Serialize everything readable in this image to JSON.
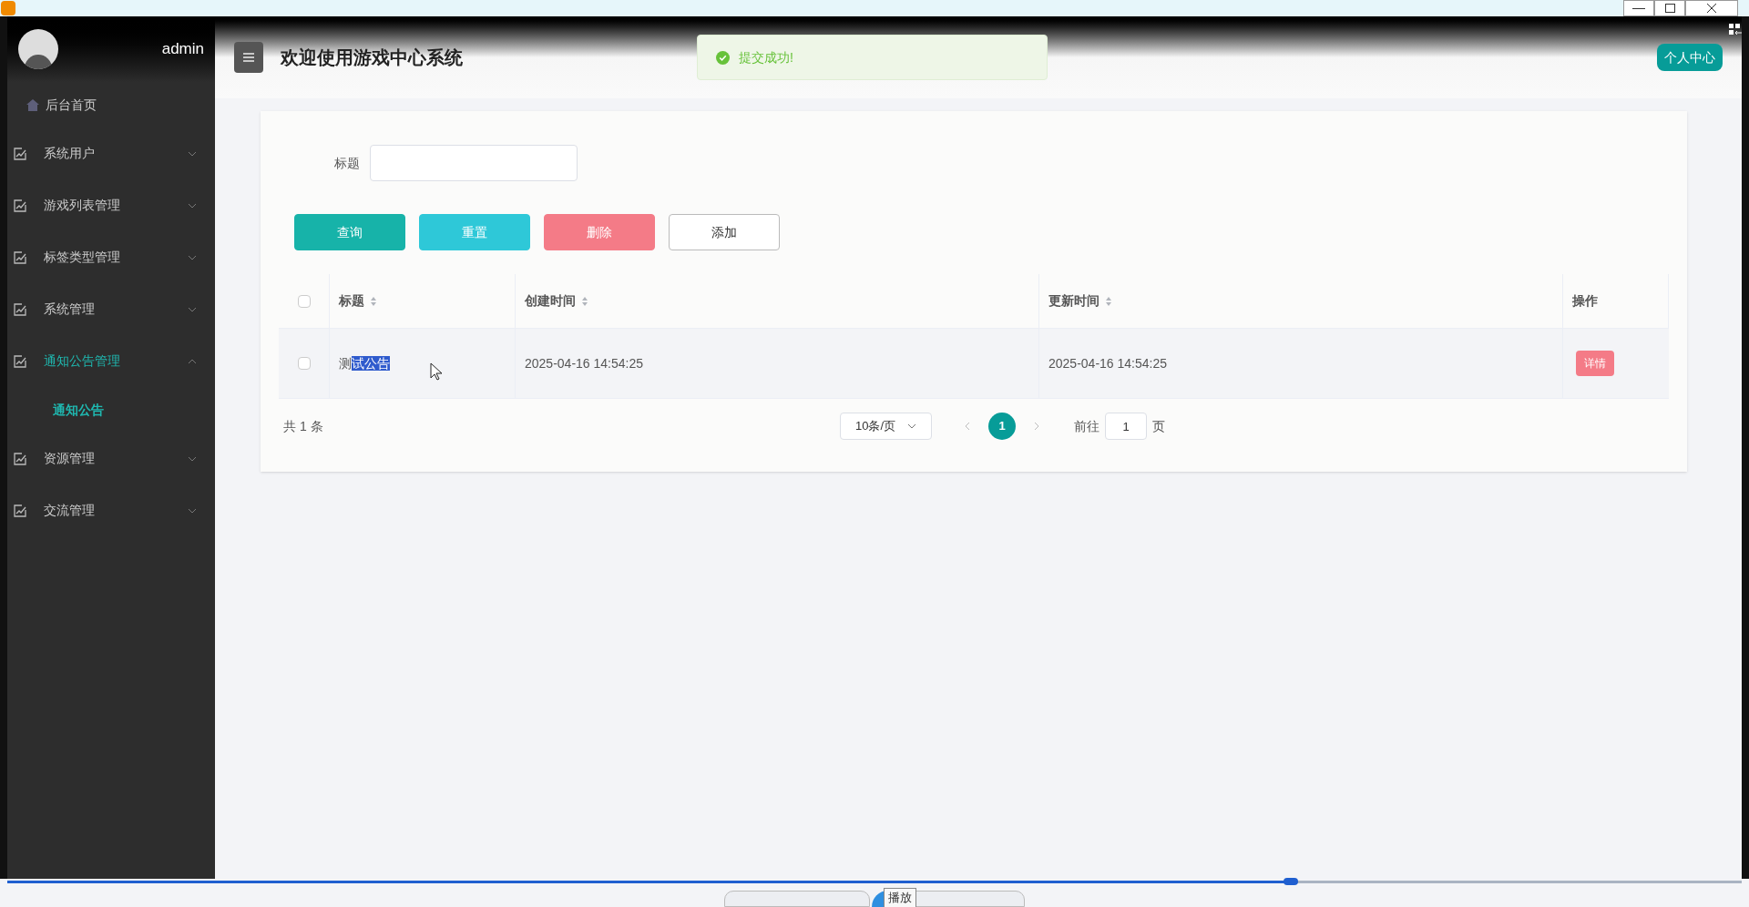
{
  "header": {
    "username": "admin",
    "title": "欢迎使用游戏中心系统",
    "toast": "提交成功!",
    "profile_button": "个人中心"
  },
  "sidebar": {
    "items": [
      {
        "kind": "home",
        "label": "后台首页",
        "selected": false
      },
      {
        "kind": "group",
        "label": "系统用户",
        "expanded": false,
        "selected": false
      },
      {
        "kind": "group",
        "label": "游戏列表管理",
        "expanded": false,
        "selected": false
      },
      {
        "kind": "group",
        "label": "标签类型管理",
        "expanded": false,
        "selected": false
      },
      {
        "kind": "group",
        "label": "系统管理",
        "expanded": false,
        "selected": false
      },
      {
        "kind": "group",
        "label": "通知公告管理",
        "expanded": true,
        "selected": true,
        "children": [
          {
            "label": "通知公告",
            "selected": true
          }
        ]
      },
      {
        "kind": "group",
        "label": "资源管理",
        "expanded": false,
        "selected": false
      },
      {
        "kind": "group",
        "label": "交流管理",
        "expanded": false,
        "selected": false
      }
    ]
  },
  "search": {
    "label": "标题"
  },
  "buttons": [
    {
      "kind": "query",
      "label": "查询"
    },
    {
      "kind": "reset",
      "label": "重置"
    },
    {
      "kind": "delete",
      "label": "删除"
    },
    {
      "kind": "add",
      "label": "添加"
    }
  ],
  "table": {
    "select_all_checked": false,
    "columns": [
      {
        "label": "标题",
        "sortable": true
      },
      {
        "label": "创建时间",
        "sortable": true
      },
      {
        "label": "更新时间",
        "sortable": true
      },
      {
        "label": "操作",
        "sortable": false
      }
    ],
    "rows": [
      {
        "checked": false,
        "title": [
          {
            "text": "测",
            "selected": false
          },
          {
            "text": "试公告",
            "selected": true
          }
        ],
        "created": "2025-04-16 14:54:25",
        "updated": "2025-04-16 14:54:25",
        "action": "详情"
      }
    ]
  },
  "pagination": {
    "total": "共 1 条",
    "page_size": "10条/页",
    "pages": [
      {
        "label": "1",
        "selected": true
      }
    ],
    "goto_label": "前往",
    "goto_value": "1",
    "goto_suffix": "页"
  },
  "player": {
    "level": 0.74,
    "tooltip": "播放"
  }
}
